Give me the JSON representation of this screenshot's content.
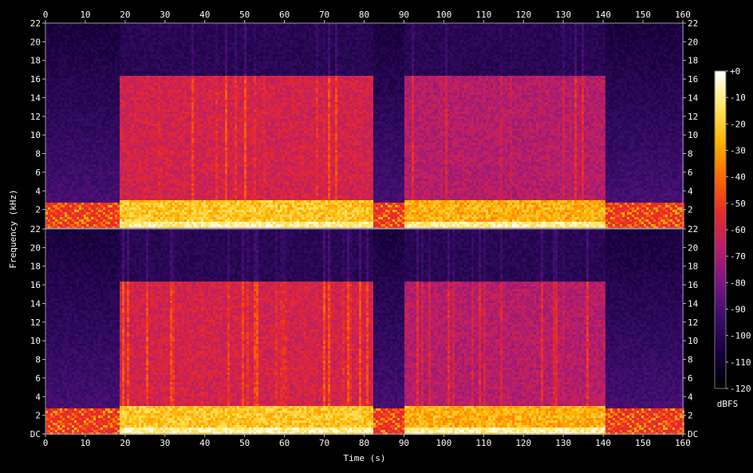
{
  "chart_data": {
    "type": "heatmap",
    "title": "",
    "xlabel": "Time (s)",
    "ylabel": "Frequency (kHz)",
    "xlim": [
      0,
      160
    ],
    "x_ticks": [
      0,
      10,
      20,
      30,
      40,
      50,
      60,
      70,
      80,
      90,
      100,
      110,
      120,
      130,
      140,
      150,
      160
    ],
    "ylim": [
      0,
      22
    ],
    "y_ticks": [
      0,
      2,
      4,
      6,
      8,
      10,
      12,
      14,
      16,
      18,
      20,
      22
    ],
    "y_tick_labels": [
      "DC",
      "2",
      "4",
      "6",
      "8",
      "10",
      "12",
      "14",
      "16",
      "18",
      "20",
      "22"
    ],
    "channels": [
      {
        "index": 1,
        "time_ranges": [
          {
            "start": 0,
            "end": 18.5,
            "level": "quiet"
          },
          {
            "start": 18.5,
            "end": 82,
            "level": "loud"
          },
          {
            "start": 82,
            "end": 90,
            "level": "quiet"
          },
          {
            "start": 90,
            "end": 140,
            "level": "medium"
          },
          {
            "start": 140,
            "end": 160,
            "level": "quiet"
          }
        ]
      },
      {
        "index": 2,
        "time_ranges": [
          {
            "start": 0,
            "end": 18.5,
            "level": "quiet"
          },
          {
            "start": 18.5,
            "end": 82,
            "level": "loud"
          },
          {
            "start": 82,
            "end": 90,
            "level": "quiet"
          },
          {
            "start": 90,
            "end": 140,
            "level": "medium"
          },
          {
            "start": 140,
            "end": 160,
            "level": "quiet"
          }
        ]
      }
    ],
    "lowpass_cutoff_khz": 16.5,
    "colorbar": {
      "label": "dBFS",
      "range": [
        -120,
        0
      ],
      "ticks": [
        0,
        -10,
        -20,
        -30,
        -40,
        -50,
        -60,
        -70,
        -80,
        -90,
        -100,
        -110,
        -120
      ],
      "tick_labels": [
        "+0",
        "-10",
        "-20",
        "-30",
        "-40",
        "-50",
        "-60",
        "-70",
        "-80",
        "-90",
        "-100",
        "-110",
        "-120"
      ],
      "colors": [
        "#000000",
        "#15003a",
        "#3a0d6b",
        "#7a1684",
        "#b81e6a",
        "#ea2a2a",
        "#ff6a00",
        "#ffb400",
        "#ffe866",
        "#ffffff"
      ]
    }
  }
}
